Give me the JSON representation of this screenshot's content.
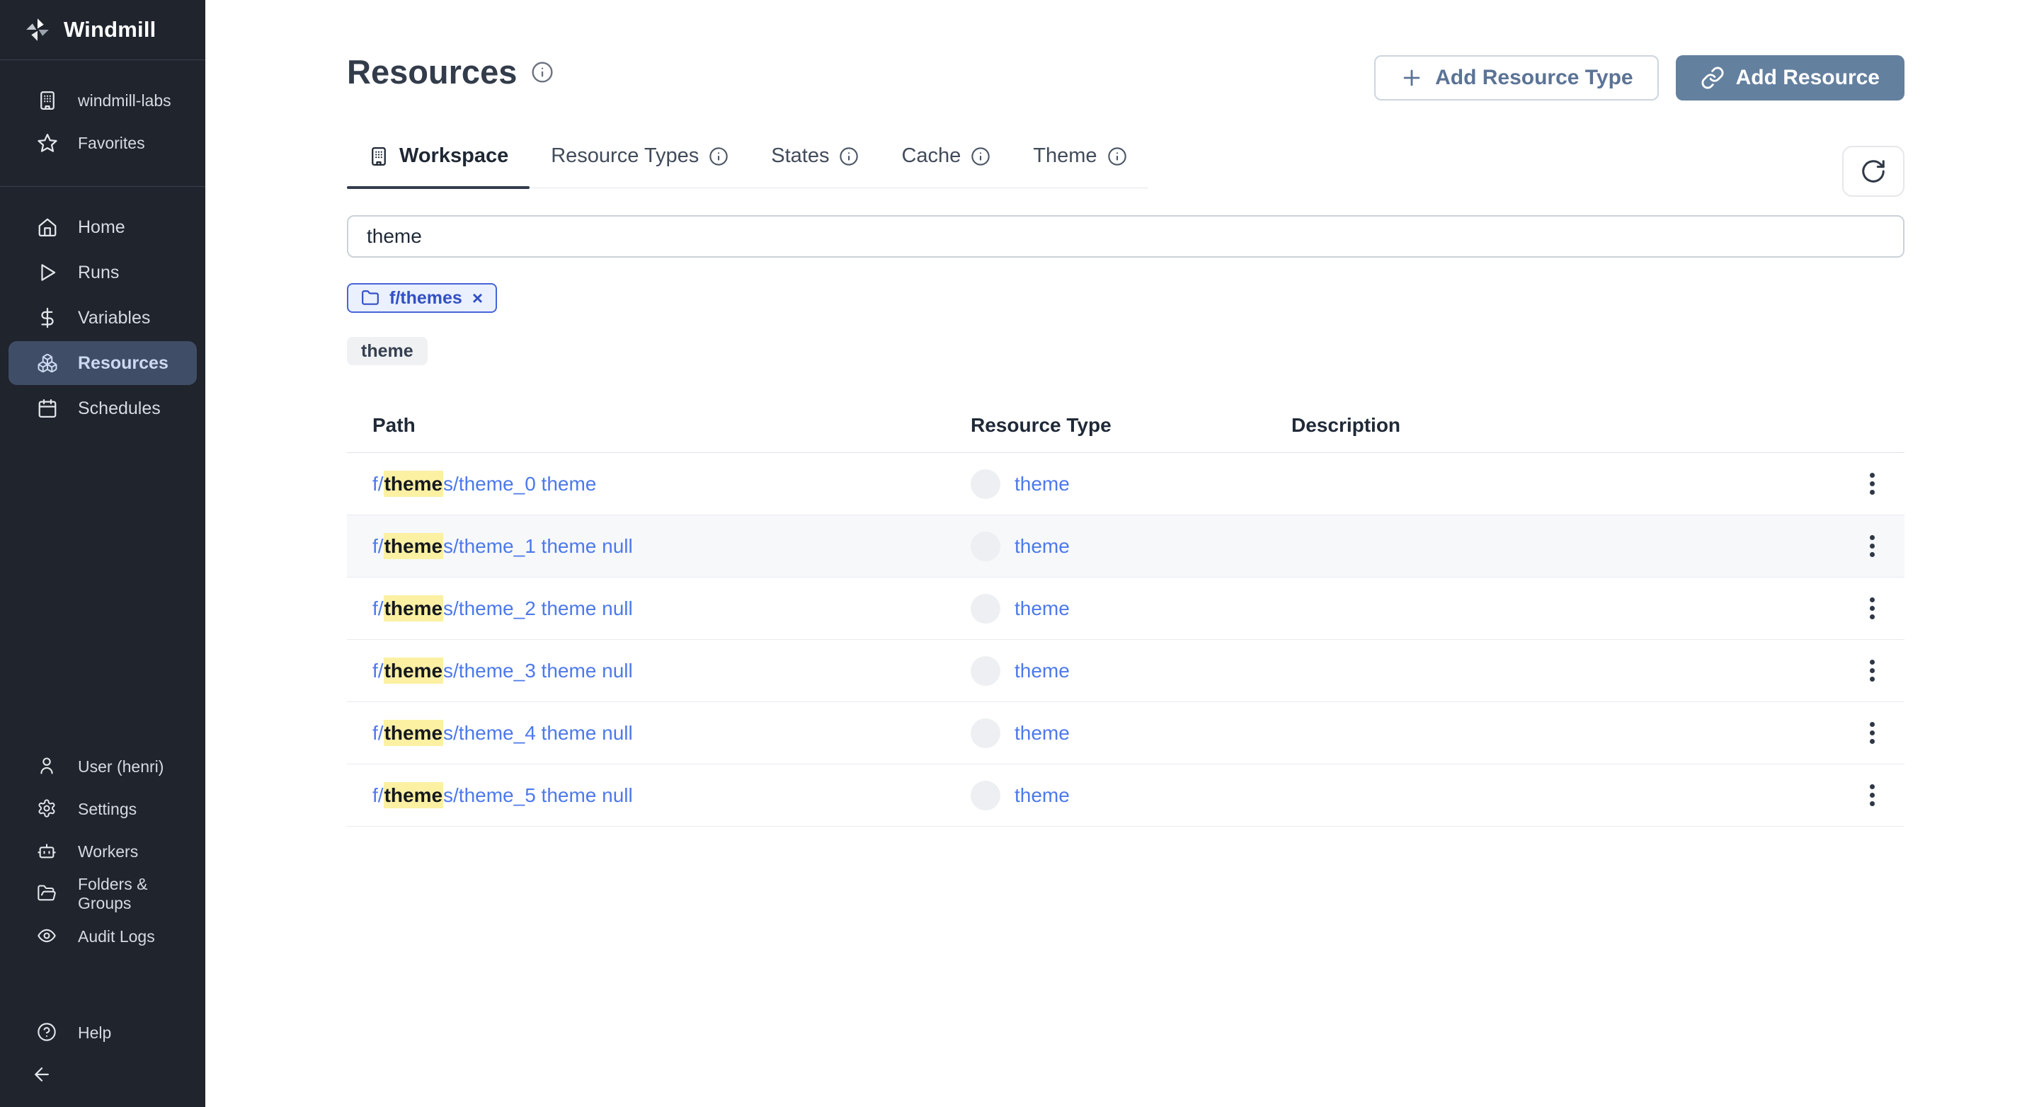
{
  "sidebar": {
    "app_name": "Windmill",
    "workspace_label": "windmill-labs",
    "favorites_label": "Favorites",
    "nav": [
      {
        "label": "Home"
      },
      {
        "label": "Runs"
      },
      {
        "label": "Variables"
      },
      {
        "label": "Resources"
      },
      {
        "label": "Schedules"
      }
    ],
    "bottom": [
      {
        "label": "User (henri)"
      },
      {
        "label": "Settings"
      },
      {
        "label": "Workers"
      },
      {
        "label": "Folders & Groups"
      },
      {
        "label": "Audit Logs"
      }
    ],
    "help_label": "Help"
  },
  "header": {
    "title": "Resources",
    "add_resource_type_label": "Add Resource Type",
    "add_resource_label": "Add Resource"
  },
  "tabs": [
    {
      "label": "Workspace",
      "active": true
    },
    {
      "label": "Resource Types",
      "active": false
    },
    {
      "label": "States",
      "active": false
    },
    {
      "label": "Cache",
      "active": false
    },
    {
      "label": "Theme",
      "active": false
    }
  ],
  "search": {
    "value": "theme"
  },
  "chips": {
    "folder": "f/themes",
    "close": "×",
    "keyword": "theme"
  },
  "table": {
    "columns": [
      "Path",
      "Resource Type",
      "Description"
    ],
    "rows": [
      {
        "path_prefix": "f/",
        "path_match": "theme",
        "path_suffix": "s/theme_0 theme",
        "resource_type": "theme",
        "description": ""
      },
      {
        "path_prefix": "f/",
        "path_match": "theme",
        "path_suffix": "s/theme_1 theme null",
        "resource_type": "theme",
        "description": ""
      },
      {
        "path_prefix": "f/",
        "path_match": "theme",
        "path_suffix": "s/theme_2 theme null",
        "resource_type": "theme",
        "description": ""
      },
      {
        "path_prefix": "f/",
        "path_match": "theme",
        "path_suffix": "s/theme_3 theme null",
        "resource_type": "theme",
        "description": ""
      },
      {
        "path_prefix": "f/",
        "path_match": "theme",
        "path_suffix": "s/theme_4 theme null",
        "resource_type": "theme",
        "description": ""
      },
      {
        "path_prefix": "f/",
        "path_match": "theme",
        "path_suffix": "s/theme_5 theme null",
        "resource_type": "theme",
        "description": ""
      }
    ]
  },
  "colors": {
    "sidebar_bg": "#1f242d",
    "active_item_bg": "#3f4d66",
    "link_blue": "#4d79ea",
    "highlight_yellow": "#fcf0a3",
    "button_fill": "#64809f",
    "chip_border_blue": "#4664d8"
  }
}
